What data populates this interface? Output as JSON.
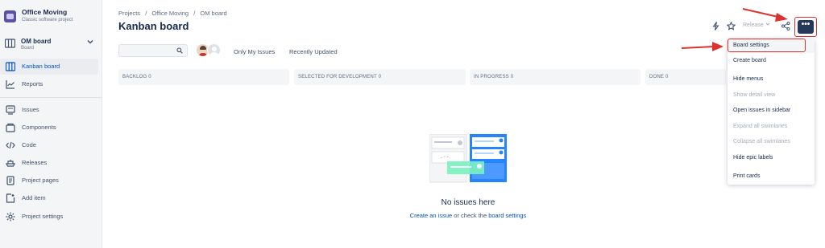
{
  "sidebar": {
    "project_name": "Office Moving",
    "project_type": "Classic software project",
    "board_name": "OM board",
    "board_sub": "Board",
    "items": [
      {
        "label": "Kanban board",
        "icon": "columns-icon"
      },
      {
        "label": "Reports",
        "icon": "chart-icon"
      },
      {
        "label": "Issues",
        "icon": "issues-icon"
      },
      {
        "label": "Components",
        "icon": "components-icon"
      },
      {
        "label": "Code",
        "icon": "code-icon"
      },
      {
        "label": "Releases",
        "icon": "ship-icon"
      },
      {
        "label": "Project pages",
        "icon": "page-icon"
      },
      {
        "label": "Add item",
        "icon": "add-item-icon"
      },
      {
        "label": "Project settings",
        "icon": "gear-icon"
      }
    ]
  },
  "header": {
    "breadcrumb": [
      "Projects",
      "/",
      "Office Moving",
      "/",
      "OM board"
    ],
    "title": "Kanban board",
    "release_label": "Release",
    "more_label": "•••"
  },
  "filters": {
    "search_placeholder": "",
    "only_my_issues": "Only My Issues",
    "recently_updated": "Recently Updated"
  },
  "columns": [
    {
      "label": "BACKLOG 0"
    },
    {
      "label": "SELECTED FOR DEVELOPMENT 0"
    },
    {
      "label": "IN PROGRESS 0"
    },
    {
      "label": "DONE 0"
    }
  ],
  "empty": {
    "title": "No issues here",
    "link1": "Create an issue",
    "middle": " or check the ",
    "link2": "board settings"
  },
  "menu": {
    "items": [
      {
        "label": "Board settings",
        "disabled": false
      },
      {
        "label": "Create board",
        "disabled": false
      },
      {
        "label": "Hide menus",
        "disabled": false
      },
      {
        "label": "Show detail view",
        "disabled": true
      },
      {
        "label": "Open issues in sidebar",
        "disabled": false
      },
      {
        "label": "Expand all swimlanes",
        "disabled": true
      },
      {
        "label": "Collapse all swimlanes",
        "disabled": true
      },
      {
        "label": "Hide epic labels",
        "disabled": false
      },
      {
        "label": "Print cards",
        "disabled": false
      }
    ]
  },
  "colors": {
    "accent": "#0052cc",
    "highlight_outline": "#e03131",
    "more_button": "#253858"
  }
}
